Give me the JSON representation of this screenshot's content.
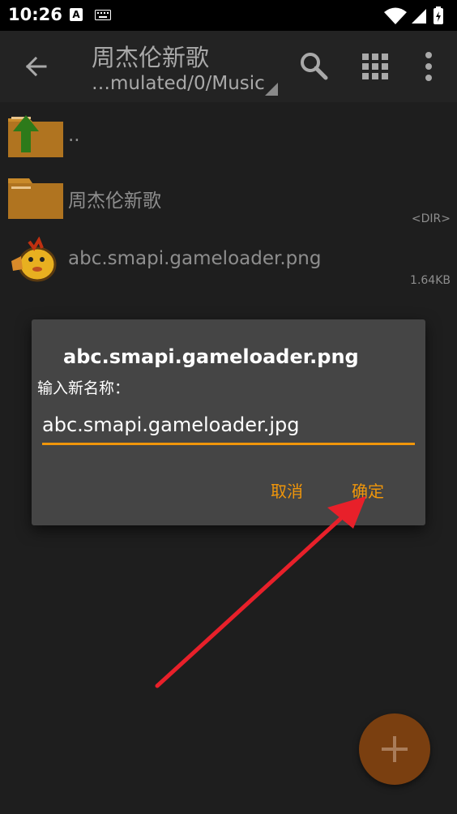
{
  "status_bar": {
    "time": "10:26",
    "notification_letter": "A"
  },
  "toolbar": {
    "title": "周杰伦新歌",
    "path": "…mulated/0/Music",
    "icons": {
      "back": "arrow-left-icon",
      "search": "search-icon",
      "view": "grid-view-icon",
      "more": "more-vert-icon"
    }
  },
  "files": [
    {
      "name": "..",
      "meta": "",
      "icon": "folder-up-icon"
    },
    {
      "name": "周杰伦新歌",
      "meta": "<DIR>",
      "icon": "folder-icon"
    },
    {
      "name": "abc.smapi.gameloader.png",
      "meta": "1.64KB",
      "icon": "image-thumbnail-icon"
    }
  ],
  "dialog": {
    "title": "abc.smapi.gameloader.png",
    "label": "输入新名称：",
    "input_value": "abc.smapi.gameloader.jpg",
    "cancel_label": "取消",
    "ok_label": "确定"
  },
  "fab": {
    "icon": "plus-icon"
  },
  "colors": {
    "accent": "#f0960a",
    "folder": "#c98a2a",
    "background": "#1e1e1e",
    "dialog": "#454545",
    "annotation": "#e8202a"
  }
}
